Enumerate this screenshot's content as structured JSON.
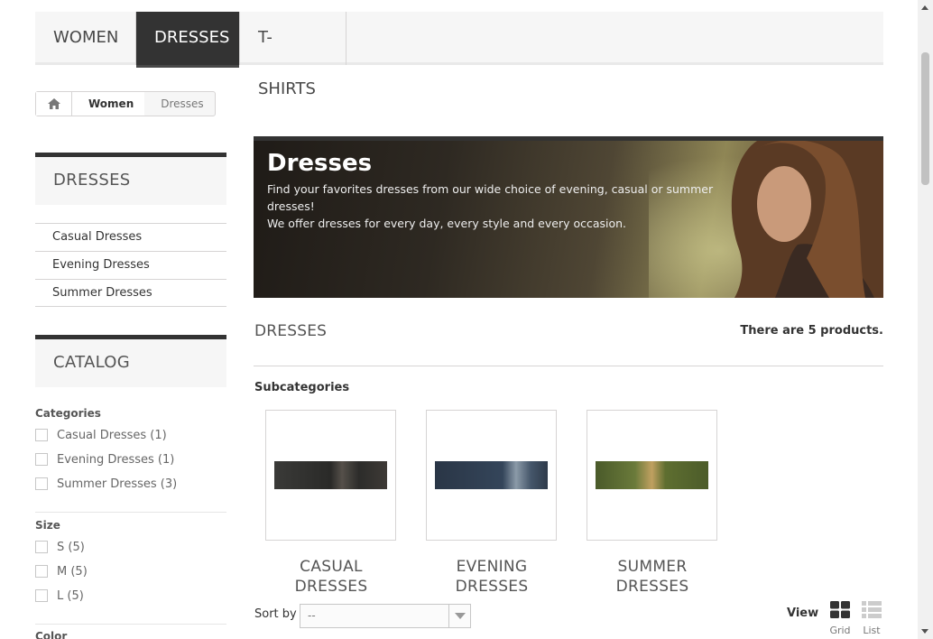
{
  "nav": {
    "tabs": [
      {
        "label": "WOMEN"
      },
      {
        "label": "DRESSES"
      },
      {
        "label": "T-SHIRTS"
      }
    ],
    "active": "DRESSES"
  },
  "breadcrumb": {
    "home_icon": "home-icon",
    "items": [
      "Women",
      "Dresses"
    ]
  },
  "sidebar": {
    "category_block": {
      "title": "DRESSES",
      "items": [
        "Casual Dresses",
        "Evening Dresses",
        "Summer Dresses"
      ]
    },
    "catalog_block": {
      "title": "CATALOG",
      "categories": {
        "label": "Categories",
        "options": [
          "Casual Dresses (1)",
          "Evening Dresses (1)",
          "Summer Dresses (3)"
        ]
      },
      "size": {
        "label": "Size",
        "options": [
          "S (5)",
          "M (5)",
          "L (5)"
        ]
      },
      "color": {
        "label": "Color"
      }
    }
  },
  "banner": {
    "title": "Dresses",
    "line1": "Find your favorites dresses from our wide choice of evening, casual or summer dresses!",
    "line2": "We offer dresses for every day, every style and every occasion."
  },
  "main": {
    "heading": "DRESSES",
    "count": "There are 5 products.",
    "subcategories_title": "Subcategories",
    "subcategories": [
      {
        "line1": "CASUAL",
        "line2": "DRESSES"
      },
      {
        "line1": "EVENING",
        "line2": "DRESSES"
      },
      {
        "line1": "SUMMER",
        "line2": "DRESSES"
      }
    ]
  },
  "toolbar": {
    "sort_label": "Sort by",
    "sort_value": "--",
    "view_label": "View",
    "view_grid": "Grid",
    "view_list": "List"
  },
  "colors": {
    "active_tab": "#333333",
    "panel_bg": "#f6f6f6",
    "border": "#d6d4d4"
  }
}
